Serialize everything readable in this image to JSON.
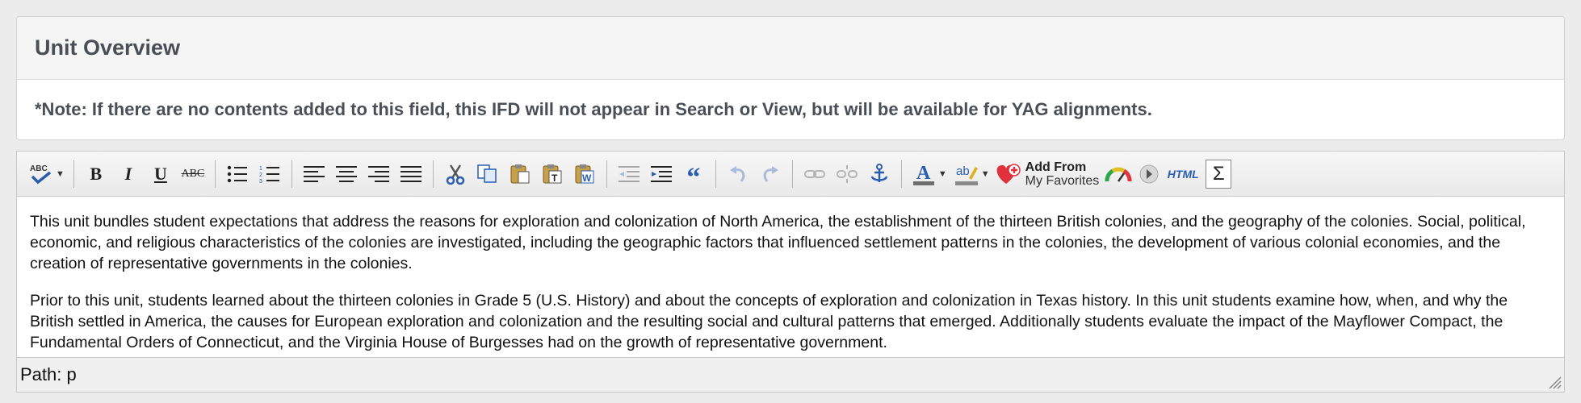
{
  "panel": {
    "title": "Unit Overview",
    "note": "*Note: If there are no contents added to this field, this IFD will not appear in Search or View, but will be available for YAG alignments."
  },
  "toolbar": {
    "spellcheck_label": "ABC",
    "bold": "B",
    "italic": "I",
    "underline": "U",
    "strike": "ABC",
    "highlight_label": "ab",
    "add_from": "Add From",
    "my_favorites": "My Favorites",
    "html_label": "HTML",
    "sigma": "Σ",
    "font_color_label": "A",
    "colors": {
      "font_color_bar": "#6e6e6e",
      "highlight_bar": "#8a8a8a",
      "accent_blue": "#2a5db0",
      "heart": "#e0323c"
    }
  },
  "editor": {
    "paragraphs": [
      "This unit bundles student expectations that address the reasons for exploration and colonization of North America, the establishment of the thirteen British colonies, and the geography of the colonies. Social, political, economic, and religious characteristics of the colonies are investigated, including the geographic factors that influenced settlement patterns in the colonies, the development of various colonial economies, and the creation of representative governments in the colonies.",
      "Prior to this unit, students learned about the thirteen colonies in Grade 5 (U.S. History) and about the concepts of exploration and colonization in Texas history. In this unit students examine how, when, and why the British settled in America, the causes for European exploration and colonization and the resulting social and cultural patterns that emerged. Additionally students evaluate the impact of the Mayflower Compact, the Fundamental Orders of Connecticut, and the Virginia House of Burgesses had on the growth of representative government."
    ],
    "path": "Path: p"
  }
}
